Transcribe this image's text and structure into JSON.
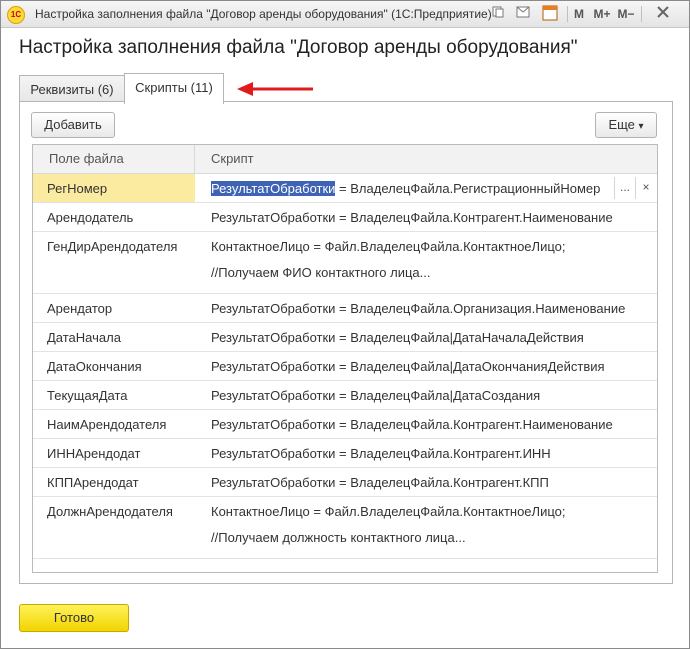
{
  "window": {
    "title": "Настройка заполнения файла \"Договор аренды оборудования\"  (1С:Предприятие)",
    "app_icon_label": "1С",
    "toolbar": {
      "m": "M",
      "m_plus": "M+",
      "m_minus": "M−",
      "calendar_day": "31"
    }
  },
  "form": {
    "heading": "Настройка заполнения файла \"Договор аренды оборудования\"",
    "tabs": [
      {
        "label": "Реквизиты (6)",
        "active": false
      },
      {
        "label": "Скрипты (11)",
        "active": true
      }
    ],
    "add_button": "Добавить",
    "more_button": "Еще",
    "more_arrow": "▾",
    "columns": {
      "field": "Поле файла",
      "script": "Скрипт"
    },
    "rows": [
      {
        "field": "РегНомер",
        "script_highlight": "РезультатОбработки",
        "script_rest": " = ВладелецФайла.РегистрационныйНомер",
        "selected": true
      },
      {
        "field": "Арендодатель",
        "script": "РезультатОбработки = ВладелецФайла.Контрагент.Наименование"
      },
      {
        "field": "ГенДирАрендодателя",
        "script": "КонтактноеЛицо = Файл.ВладелецФайла.КонтактноеЛицо;",
        "script2": "//Получаем ФИО контактного лица..."
      },
      {
        "field": "Арендатор",
        "script": "РезультатОбработки = ВладелецФайла.Организация.Наименование"
      },
      {
        "field": "ДатаНачала",
        "script": "РезультатОбработки = ВладелецФайла|ДатаНачалаДействия"
      },
      {
        "field": "ДатаОкончания",
        "script": "РезультатОбработки = ВладелецФайла|ДатаОкончанияДействия"
      },
      {
        "field": "ТекущаяДата",
        "script": "РезультатОбработки = ВладелецФайла|ДатаСоздания"
      },
      {
        "field": "НаимАрендодателя",
        "script": "РезультатОбработки = ВладелецФайла.Контрагент.Наименование"
      },
      {
        "field": "ИННАрендодат",
        "script": "РезультатОбработки = ВладелецФайла.Контрагент.ИНН"
      },
      {
        "field": "КППАрендодат",
        "script": "РезультатОбработки = ВладелецФайла.Контрагент.КПП"
      },
      {
        "field": "ДолжнАрендодателя",
        "script": "КонтактноеЛицо = Файл.ВладелецФайла.КонтактноеЛицо;",
        "script2": "//Получаем должность контактного лица..."
      }
    ],
    "edit_buttons": {
      "select": "...",
      "clear": "×"
    },
    "ok_button": "Готово"
  },
  "colors": {
    "accent_yellow": "#f5dc1a",
    "selection_blue": "#3e63b4",
    "arrow_red": "#e01b1b"
  }
}
